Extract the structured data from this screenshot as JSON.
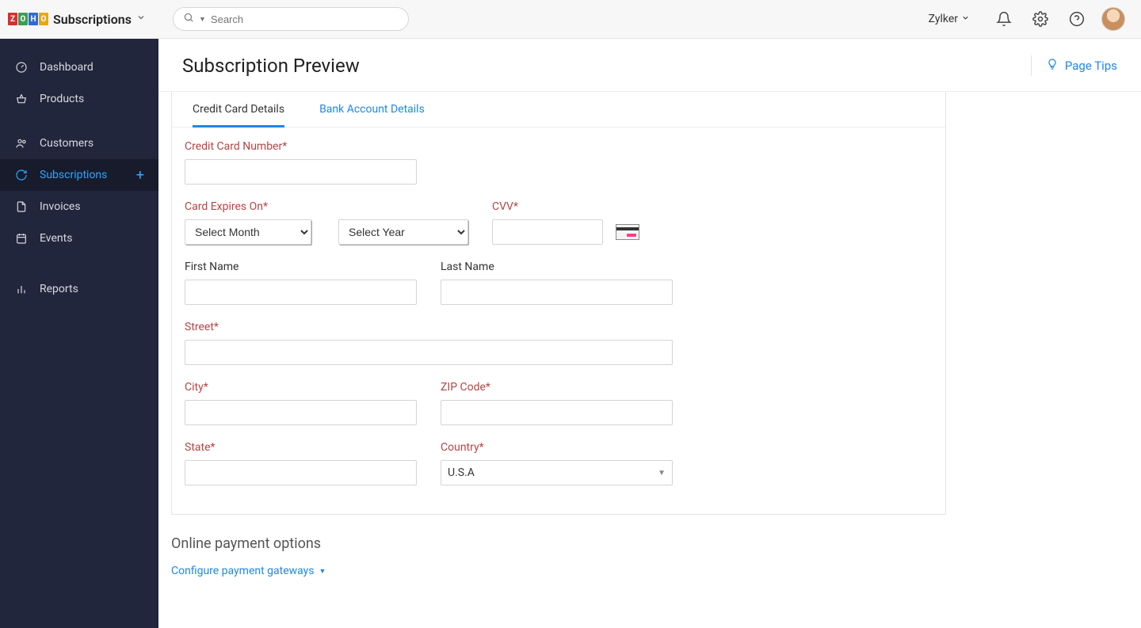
{
  "brand": {
    "name": "Subscriptions"
  },
  "search": {
    "placeholder": "Search"
  },
  "org": {
    "name": "Zylker"
  },
  "page_tips": "Page Tips",
  "sidebar": {
    "items": [
      {
        "label": "Dashboard"
      },
      {
        "label": "Products"
      },
      {
        "label": "Customers"
      },
      {
        "label": "Subscriptions"
      },
      {
        "label": "Invoices"
      },
      {
        "label": "Events"
      },
      {
        "label": "Reports"
      }
    ]
  },
  "page": {
    "title": "Subscription Preview"
  },
  "tabs": {
    "credit_card": "Credit Card Details",
    "bank_account": "Bank Account Details"
  },
  "form": {
    "cc_number": "Credit Card Number*",
    "expires": "Card Expires On*",
    "month_placeholder": "Select Month",
    "year_placeholder": "Select Year",
    "cvv": "CVV*",
    "first_name": "First Name",
    "last_name": "Last Name",
    "street": "Street*",
    "city": "City*",
    "zip": "ZIP Code*",
    "state": "State*",
    "country": "Country*",
    "country_value": "U.S.A"
  },
  "online_payment": {
    "title": "Online payment options",
    "configure": "Configure payment gateways"
  }
}
